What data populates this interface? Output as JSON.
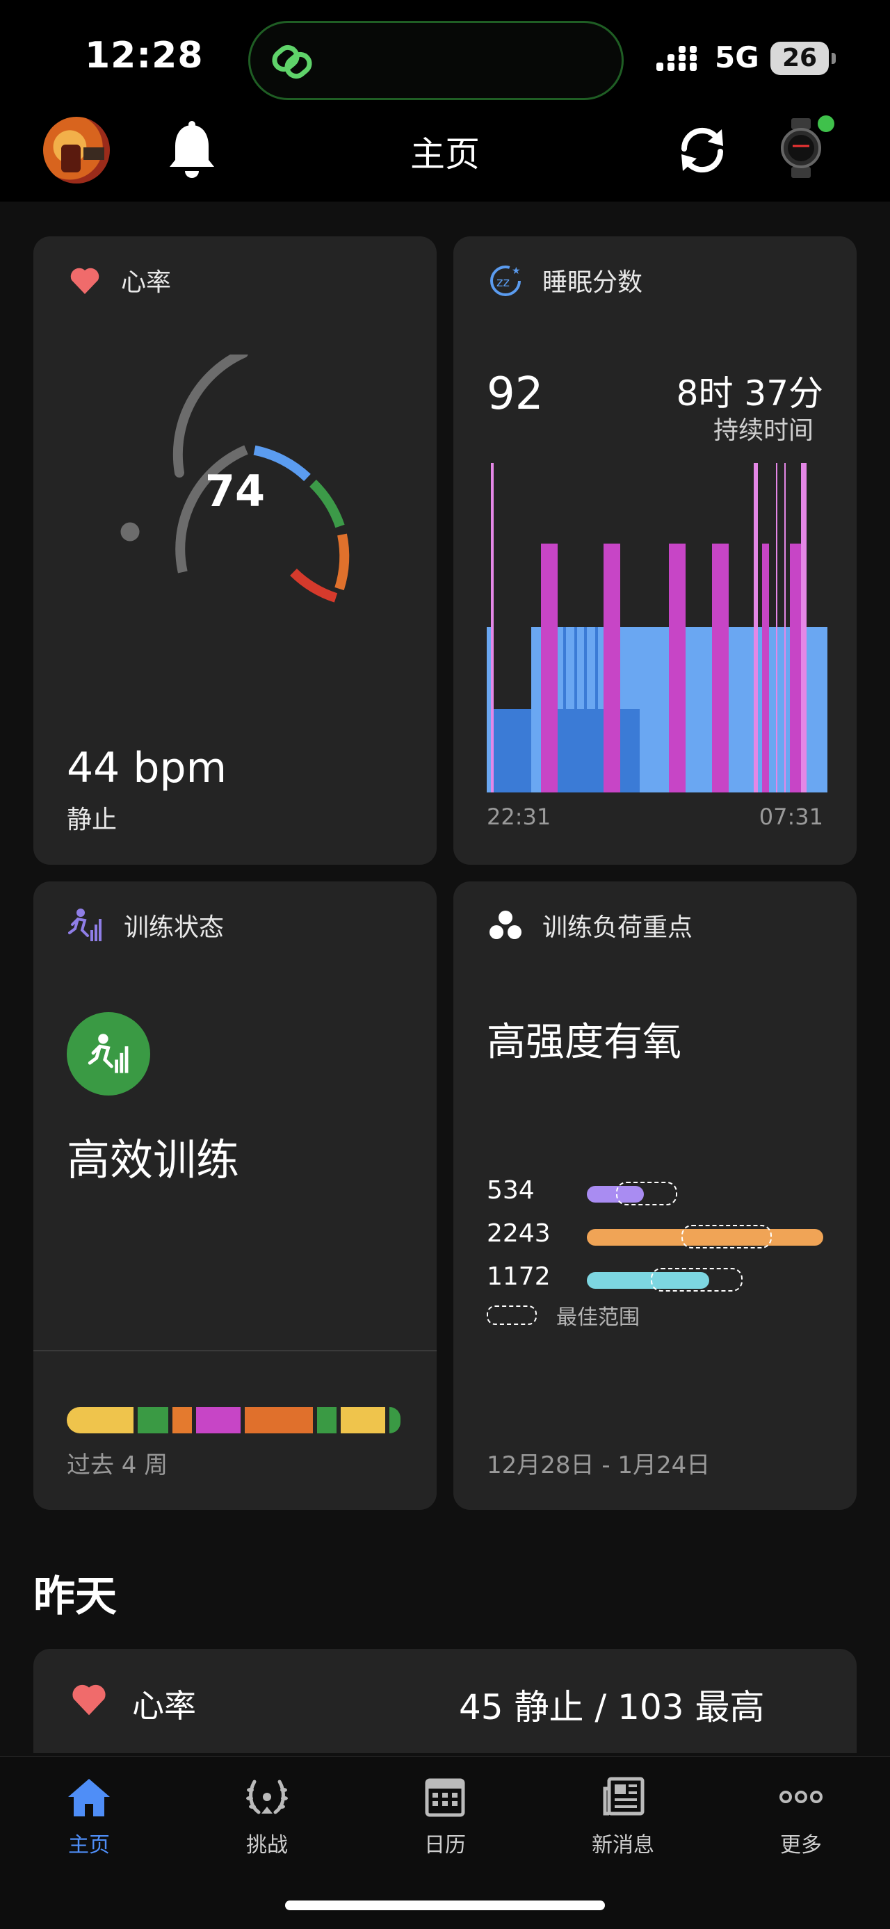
{
  "status_bar": {
    "time": "12:28",
    "network": "5G",
    "battery": "26"
  },
  "header": {
    "title": "主页"
  },
  "heart_rate_card": {
    "title": "心率",
    "current_value": "74",
    "resting_value": "44 bpm",
    "resting_label": "静止"
  },
  "sleep_card": {
    "title": "睡眠分数",
    "score": "92",
    "duration": "8时 37分",
    "duration_label": "持续时间",
    "start_time": "22:31",
    "end_time": "07:31"
  },
  "training_status_card": {
    "title": "训练状态",
    "status": "高效训练",
    "period": "过去 4 周",
    "bar_colors": [
      "#efc44c",
      "#3a9a44",
      "#e47a2e",
      "#c745c6",
      "#e0702c",
      "#3a9a44",
      "#efc44c",
      "#3a9a44"
    ]
  },
  "training_load_card": {
    "title": "训练负荷重点",
    "focus": "高强度有氧",
    "rows": [
      {
        "value": "534",
        "color": "#a98cf2",
        "fill": 0.24
      },
      {
        "value": "2243",
        "color": "#f0a456",
        "fill": 1.0
      },
      {
        "value": "1172",
        "color": "#7dd6e1",
        "fill": 0.52
      }
    ],
    "legend": "最佳范围",
    "date_range": "12月28日 - 1月24日"
  },
  "yesterday": {
    "heading": "昨天",
    "heart_rate_label": "心率",
    "heart_rate_summary": "45 静止 / 103 最高"
  },
  "tabs": [
    {
      "label": "主页",
      "icon": "home-icon",
      "active": true
    },
    {
      "label": "挑战",
      "icon": "laurel-icon",
      "active": false
    },
    {
      "label": "日历",
      "icon": "calendar-icon",
      "active": false
    },
    {
      "label": "新消息",
      "icon": "news-icon",
      "active": false
    },
    {
      "label": "更多",
      "icon": "more-icon",
      "active": false
    }
  ],
  "colors": {
    "accent": "#4f8ef7",
    "card": "#242424",
    "heart": "#f06b6b"
  }
}
